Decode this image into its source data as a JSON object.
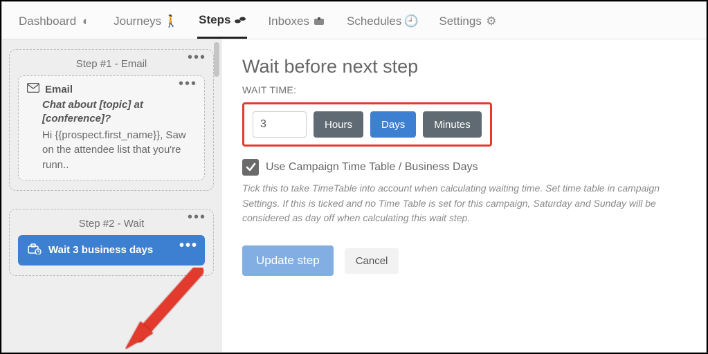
{
  "tabs": {
    "dashboard": "Dashboard",
    "journeys": "Journeys",
    "steps": "Steps",
    "inboxes": "Inboxes",
    "schedules": "Schedules",
    "settings": "Settings"
  },
  "sidebar": {
    "step1": {
      "title": "Step #1 - Email",
      "email_label": "Email",
      "subject": "Chat about [topic] at [conference]?",
      "body": "Hi {{prospect.first_name}}, Saw on the attendee list that you're runn.."
    },
    "step2": {
      "title": "Step #2 - Wait",
      "chip": "Wait 3 business days"
    }
  },
  "main": {
    "heading": "Wait before next step",
    "wait_label": "WAIT TIME:",
    "value": "3",
    "units": {
      "hours": "Hours",
      "days": "Days",
      "minutes": "Minutes"
    },
    "selected_unit": "days",
    "checkbox_label": "Use Campaign Time Table / Business Days",
    "help": "Tick this to take TimeTable into account when calculating waiting time. Set time table in campaign Settings. If this is ticked and no Time Table is set for this campaign, Saturday and Sunday will be considered as day off when calculating this wait step.",
    "update": "Update step",
    "cancel": "Cancel"
  }
}
